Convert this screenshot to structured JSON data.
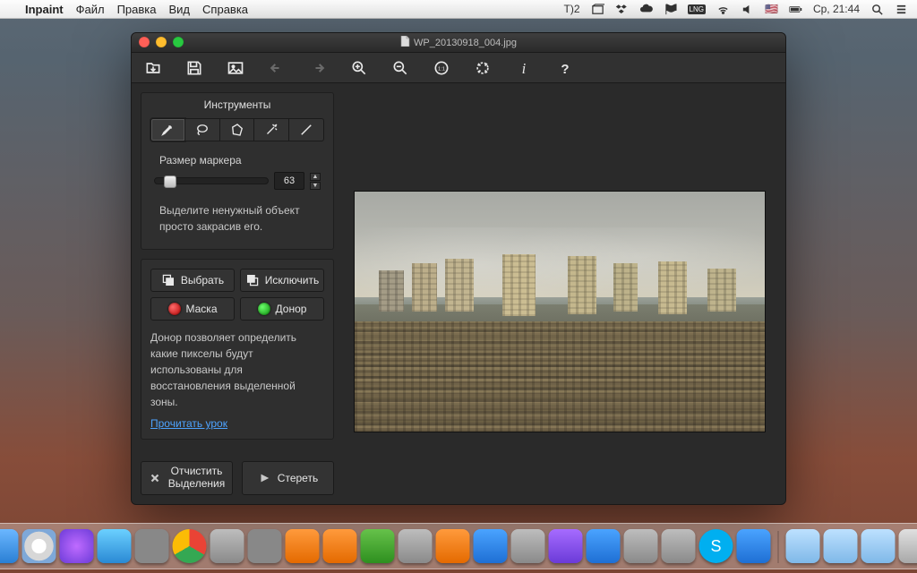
{
  "menubar": {
    "app_name": "Inpaint",
    "items": [
      "Файл",
      "Правка",
      "Вид",
      "Справка"
    ],
    "right": {
      "td": "2",
      "clock": "Ср, 21:44",
      "flag": "🇺🇸"
    }
  },
  "window": {
    "title_prefix": "📄",
    "title": "WP_20130918_004.jpg"
  },
  "toolbar": {
    "open": "open",
    "save": "save",
    "image": "image",
    "undo": "undo",
    "redo": "redo",
    "zoom_in": "zoom-in",
    "zoom_out": "zoom-out",
    "zoom_11": "1:1",
    "fit": "fit",
    "info": "info",
    "help": "help"
  },
  "sidebar": {
    "tools_title": "Инструменты",
    "marker_label": "Размер маркера",
    "marker_value": "63",
    "hint1": "Выделите ненужный объект просто закрасив его.",
    "select_btn": "Выбрать",
    "exclude_btn": "Исключить",
    "mask_btn": "Маска",
    "donor_btn": "Донор",
    "donor_text": "Донор позволяет определить какие пикселы будут использованы для восстановления выделенной зоны.",
    "read_link": "Прочитать урок",
    "clear_btn_l1": "Отчистить",
    "clear_btn_l2": "Выделения",
    "erase_btn": "Стереть"
  }
}
